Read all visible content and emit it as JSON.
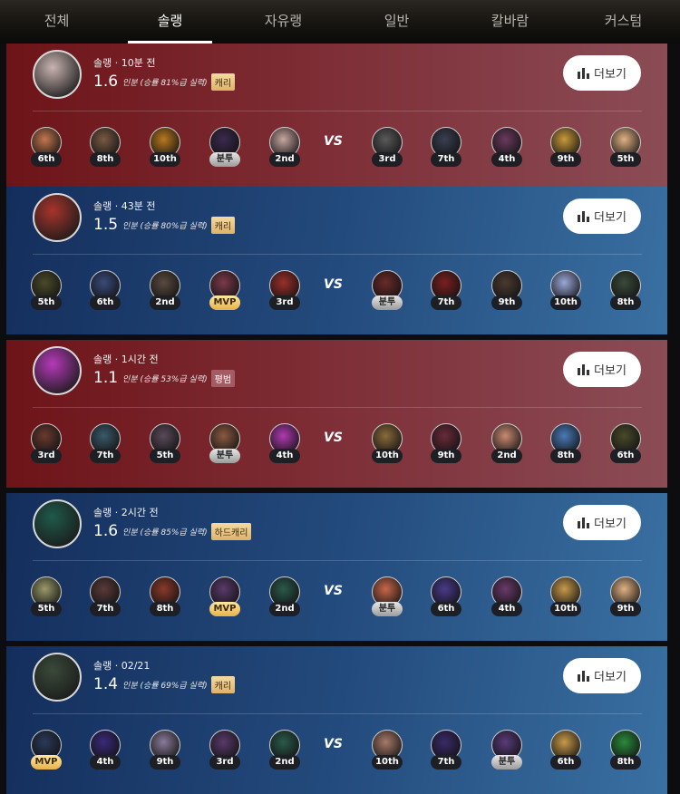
{
  "tabs": [
    {
      "label": "전체",
      "active": false
    },
    {
      "label": "솔랭",
      "active": true
    },
    {
      "label": "자유랭",
      "active": false
    },
    {
      "label": "일반",
      "active": false
    },
    {
      "label": "칼바람",
      "active": false
    },
    {
      "label": "커스텀",
      "active": false
    }
  ],
  "more_label": "더보기",
  "vs_label": "VS",
  "matches": [
    {
      "theme": "red",
      "queue_time": "솔랭 · 10분 전",
      "score": "1.6",
      "score_sub": "인분 (승률 81%급 실력)",
      "tag": "캐리",
      "tag_style": "gold",
      "avatar_color": "#c9b4b0",
      "team_a": [
        {
          "rank": "6th",
          "color": "#c4774f"
        },
        {
          "rank": "8th",
          "color": "#7a5a44"
        },
        {
          "rank": "10th",
          "color": "#b8791f"
        },
        {
          "rank": "분투",
          "color": "#3c2a4e"
        },
        {
          "rank": "2nd",
          "color": "#c8a6a0"
        }
      ],
      "team_b": [
        {
          "rank": "3rd",
          "color": "#5a5a5a"
        },
        {
          "rank": "7th",
          "color": "#3a3f52"
        },
        {
          "rank": "4th",
          "color": "#6a3a5e"
        },
        {
          "rank": "9th",
          "color": "#c89a3a"
        },
        {
          "rank": "5th",
          "color": "#e1b283"
        }
      ]
    },
    {
      "theme": "blue",
      "queue_time": "솔랭 · 43분 전",
      "score": "1.5",
      "score_sub": "인분 (승률 80%급 실력)",
      "tag": "캐리",
      "tag_style": "gold",
      "avatar_color": "#a8342c",
      "team_a": [
        {
          "rank": "5th",
          "color": "#4a4a2a"
        },
        {
          "rank": "6th",
          "color": "#3a4a7a"
        },
        {
          "rank": "2nd",
          "color": "#5a4a40"
        },
        {
          "rank": "MVP",
          "color": "#7a3a4a"
        },
        {
          "rank": "3rd",
          "color": "#9a2f2a"
        }
      ],
      "team_b": [
        {
          "rank": "분투",
          "color": "#6a2a2a"
        },
        {
          "rank": "7th",
          "color": "#7a1f1f"
        },
        {
          "rank": "9th",
          "color": "#4a3a30"
        },
        {
          "rank": "10th",
          "color": "#9aa8d8"
        },
        {
          "rank": "8th",
          "color": "#3a4a3a"
        }
      ]
    },
    {
      "theme": "red",
      "queue_time": "솔랭 · 1시간 전",
      "score": "1.1",
      "score_sub": "인분 (승률 53%급 실력)",
      "tag": "평범",
      "tag_style": "plain",
      "avatar_color": "#b53ab8",
      "team_a": [
        {
          "rank": "3rd",
          "color": "#6a3a30"
        },
        {
          "rank": "7th",
          "color": "#3a5a6a"
        },
        {
          "rank": "5th",
          "color": "#5a4a5a"
        },
        {
          "rank": "분투",
          "color": "#8a5a40"
        },
        {
          "rank": "4th",
          "color": "#b03ab0"
        }
      ],
      "team_b": [
        {
          "rank": "10th",
          "color": "#8a6a3a"
        },
        {
          "rank": "9th",
          "color": "#6a2a3a"
        },
        {
          "rank": "2nd",
          "color": "#c88a70"
        },
        {
          "rank": "8th",
          "color": "#4a7ab8"
        },
        {
          "rank": "6th",
          "color": "#4a4a2a"
        }
      ]
    },
    {
      "theme": "blue",
      "queue_time": "솔랭 · 2시간 전",
      "score": "1.6",
      "score_sub": "인분 (승률 85%급 실력)",
      "tag": "하드캐리",
      "tag_style": "gold",
      "avatar_color": "#1f5a4a",
      "team_a": [
        {
          "rank": "5th",
          "color": "#9a9a6a"
        },
        {
          "rank": "7th",
          "color": "#5a3a3a"
        },
        {
          "rank": "8th",
          "color": "#8a3a2a"
        },
        {
          "rank": "MVP",
          "color": "#5a3a6a"
        },
        {
          "rank": "2nd",
          "color": "#2a5a4a"
        }
      ],
      "team_b": [
        {
          "rank": "분투",
          "color": "#c8684a"
        },
        {
          "rank": "6th",
          "color": "#4a3a8a"
        },
        {
          "rank": "4th",
          "color": "#6a3a6a"
        },
        {
          "rank": "10th",
          "color": "#c89a4a"
        },
        {
          "rank": "9th",
          "color": "#e1b283"
        }
      ]
    },
    {
      "theme": "blue",
      "queue_time": "솔랭 · 02/21",
      "score": "1.4",
      "score_sub": "인분 (승률 69%급 실력)",
      "tag": "캐리",
      "tag_style": "gold",
      "avatar_color": "#3a4a3a",
      "team_a": [
        {
          "rank": "MVP",
          "color": "#2a3a5a"
        },
        {
          "rank": "4th",
          "color": "#3a2a7a"
        },
        {
          "rank": "9th",
          "color": "#8a7a9a"
        },
        {
          "rank": "3rd",
          "color": "#5a3a6a"
        },
        {
          "rank": "2nd",
          "color": "#2a5a4a"
        }
      ],
      "team_b": [
        {
          "rank": "10th",
          "color": "#a87a6a"
        },
        {
          "rank": "7th",
          "color": "#3a2a6a"
        },
        {
          "rank": "분투",
          "color": "#5a3a7a"
        },
        {
          "rank": "6th",
          "color": "#c89a4a"
        },
        {
          "rank": "8th",
          "color": "#2a8a3a"
        }
      ]
    }
  ]
}
